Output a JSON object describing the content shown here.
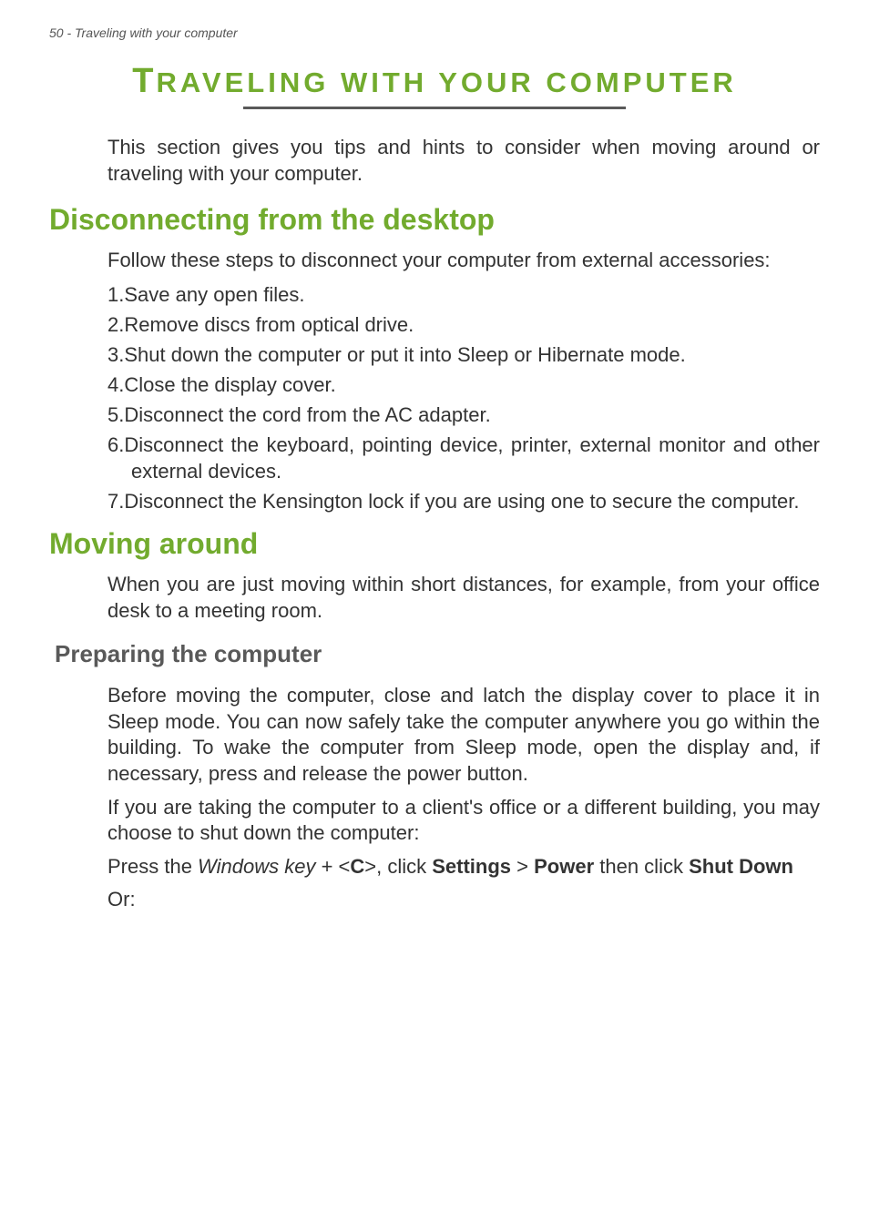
{
  "header": {
    "running": "50 - Traveling with your computer"
  },
  "title": {
    "first_char": "T",
    "rest": "RAVELING WITH YOUR COMPUTER"
  },
  "intro": "This section gives you tips and hints to consider when moving around or traveling with your computer.",
  "sections": {
    "disconnecting": {
      "heading": "Disconnecting from the desktop",
      "lead": "Follow these steps to disconnect your computer from external accessories:",
      "steps": [
        "Save any open files.",
        "Remove discs from optical drive.",
        "Shut down the computer or put it into Sleep or Hibernate mode.",
        "Close the display cover.",
        "Disconnect the cord from the AC adapter.",
        "Disconnect the keyboard, pointing device, printer, external monitor and other external devices.",
        "Disconnect the Kensington lock if you are using one to secure the computer."
      ]
    },
    "moving": {
      "heading": "Moving around",
      "lead": "When you are just moving within short distances, for example, from your office desk to a meeting room.",
      "preparing": {
        "heading": "Preparing the computer",
        "p1": "Before moving the computer, close and latch the display cover to place it in Sleep mode. You can now safely take the computer anywhere you go within the building. To wake the computer from Sleep mode, open the display and, if necessary, press and release the power button.",
        "p2": "If you are taking the computer to a client's office or a different building, you may choose to shut down the computer:",
        "p3": {
          "pre": "Press the ",
          "winkey": "Windows key",
          "plus": " + <",
          "c": "C",
          "after_c": ">, click ",
          "settings": "Settings",
          "gt": " > ",
          "power": "Power",
          "then": " then click ",
          "shut": "Shut Down"
        },
        "or": "Or:"
      }
    }
  }
}
